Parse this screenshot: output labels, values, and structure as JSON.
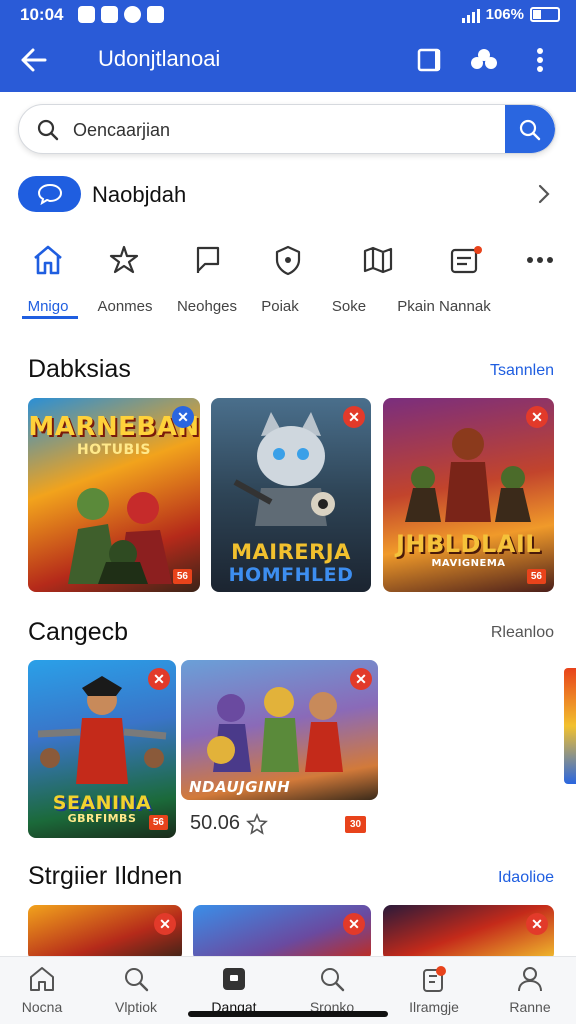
{
  "status": {
    "time": "10:04",
    "battery": "106%"
  },
  "appbar": {
    "title": "Udonjtlanoai"
  },
  "search": {
    "placeholder": "Oencaarjian"
  },
  "profile_row": {
    "label": "Naobjdah"
  },
  "categories": [
    {
      "label": "Mnigo",
      "icon": "home-icon",
      "active": true
    },
    {
      "label": "Aonmes",
      "icon": "star-icon"
    },
    {
      "label": "Neohges",
      "icon": "flag-icon"
    },
    {
      "label": "Poiak",
      "icon": "shield-icon"
    },
    {
      "label": "Soke",
      "icon": "map-icon"
    },
    {
      "label": "Pkain Nannak",
      "icon": "inbox-icon"
    }
  ],
  "sections": [
    {
      "title": "Dabksias",
      "link": "Tsannlen",
      "link_color": "#1f5ee0",
      "cards": [
        {
          "caption": "MARNEBAN",
          "sub": "HOTUBIS",
          "badge": "56"
        },
        {
          "caption": "MAIRERJA",
          "sub": "HOMFHLED",
          "badge": ""
        },
        {
          "caption": "JHBLDLAIL",
          "sub": "MAVIGNEMA",
          "badge": "56"
        }
      ]
    },
    {
      "title": "Cangecb",
      "link": "Rleanloo",
      "link_color": "#555555",
      "cards": [
        {
          "caption": "SEANINA",
          "sub": "GBRFIMBS",
          "badge": "56"
        },
        {
          "caption": "NDAUJGINH",
          "sub": "",
          "badge": "30"
        }
      ],
      "price": "50.06"
    },
    {
      "title": "Strgiier Ildnen",
      "link": "Idaolioe",
      "link_color": "#1f5ee0"
    }
  ],
  "bottom_nav": [
    {
      "label": "Nocna",
      "icon": "home-icon"
    },
    {
      "label": "Vlptiok",
      "icon": "search-icon"
    },
    {
      "label": "Dangat",
      "icon": "bag-icon",
      "active": true
    },
    {
      "label": "Sronko",
      "icon": "search-icon"
    },
    {
      "label": "Ilramgje",
      "icon": "notification-icon"
    },
    {
      "label": "Ranne",
      "icon": "profile-icon"
    }
  ]
}
